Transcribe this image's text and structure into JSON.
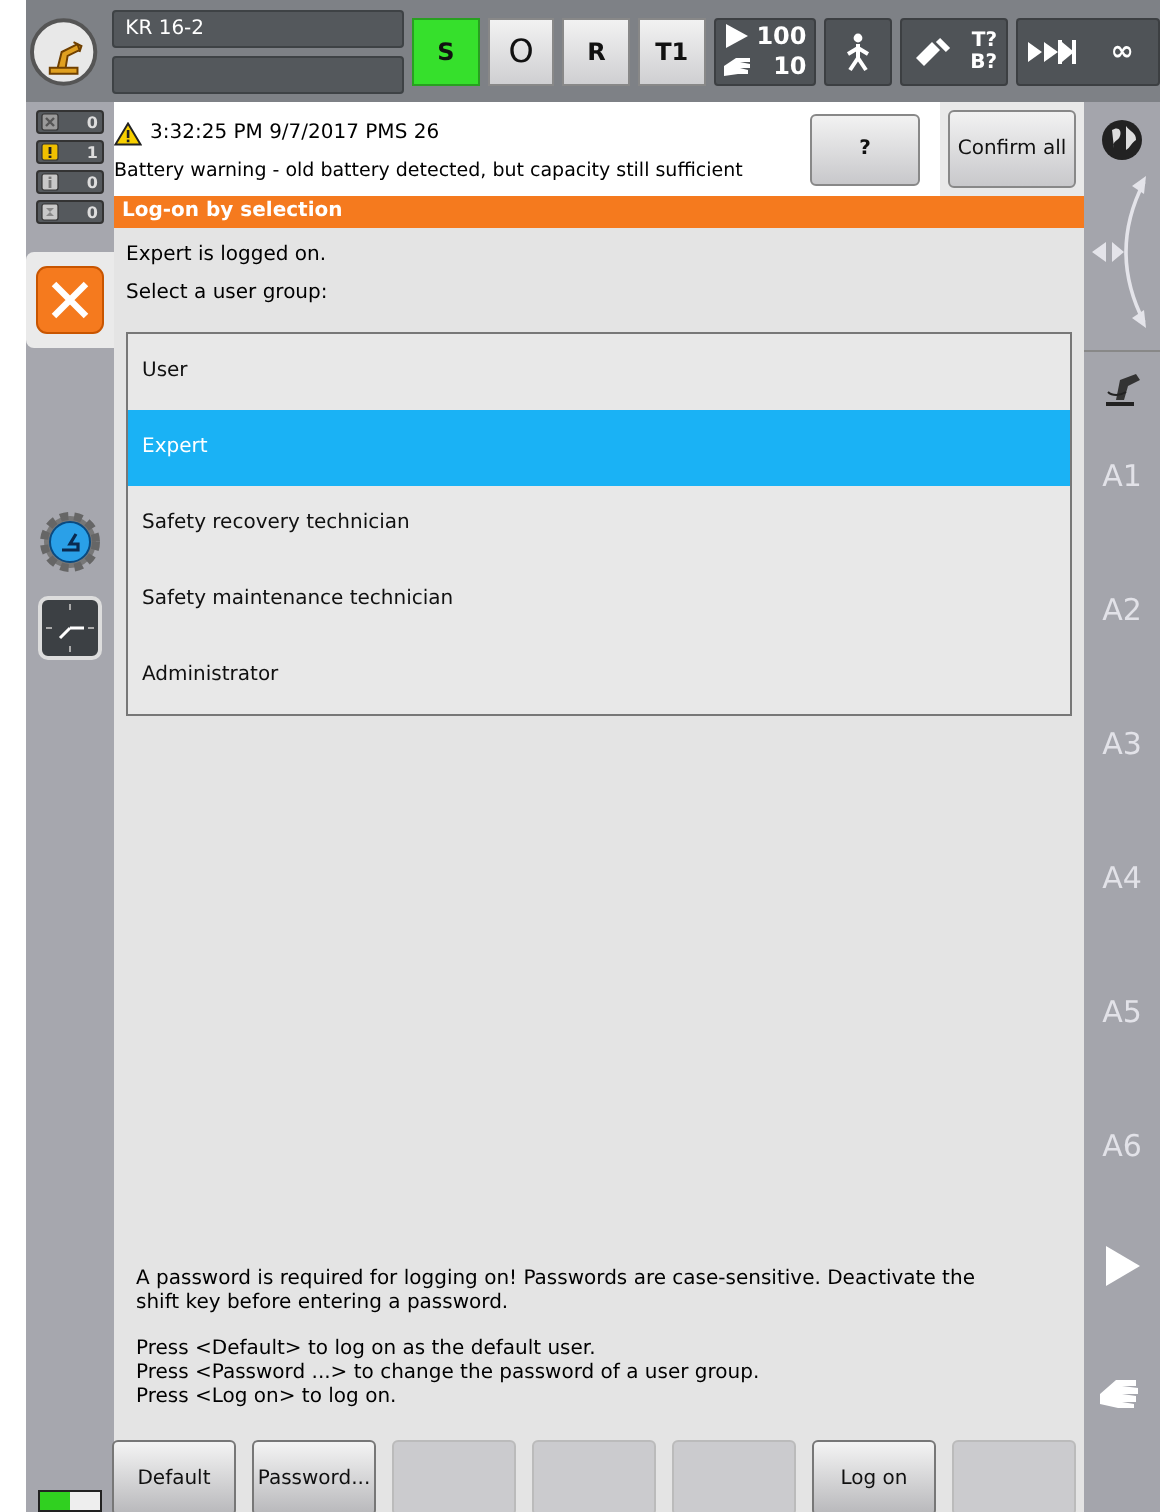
{
  "header": {
    "robot_name": "KR 16-2",
    "status_keys": [
      {
        "label": "S",
        "selected": true
      },
      {
        "label": "O",
        "kind": "circle",
        "selected": false
      },
      {
        "label": "R",
        "selected": false
      },
      {
        "label": "T1",
        "selected": false
      }
    ],
    "override": {
      "program": "100",
      "jog": "10"
    },
    "tool": {
      "tool": "T?",
      "base": "B?"
    },
    "increment": "∞"
  },
  "message_counters": [
    {
      "kind": "acknowledge",
      "count": "0"
    },
    {
      "kind": "warning",
      "count": "1"
    },
    {
      "kind": "info",
      "count": "0"
    },
    {
      "kind": "wait",
      "count": "0"
    }
  ],
  "message": {
    "kind": "warning",
    "header": "3:32:25 PM 9/7/2017 PMS 26",
    "text": "Battery warning - old battery detected, but capacity still sufficient",
    "help_label": "?",
    "confirm_label": "Confirm all"
  },
  "dialog": {
    "title": "Log-on by selection",
    "status": "Expert is logged on.",
    "prompt": "Select a user group:",
    "groups": [
      {
        "label": "User",
        "selected": false
      },
      {
        "label": "Expert",
        "selected": true
      },
      {
        "label": "Safety recovery technician",
        "selected": false
      },
      {
        "label": "Safety maintenance technician",
        "selected": false
      },
      {
        "label": "Administrator",
        "selected": false
      }
    ],
    "notes": [
      "A password is required for logging on! Passwords are case-sensitive. Deactivate the shift key before entering a password.",
      "Press <Default> to log on as the default user.\nPress <Password ...> to change the password of a user group.\nPress <Log on> to log on."
    ]
  },
  "softkeys": [
    {
      "label": "Default",
      "enabled": true
    },
    {
      "label": "Password...",
      "enabled": true
    },
    {
      "enabled": false
    },
    {
      "enabled": false
    },
    {
      "enabled": false
    },
    {
      "label": "Log on",
      "enabled": true
    },
    {
      "enabled": false
    }
  ],
  "axis_keys": [
    "A1",
    "A2",
    "A3",
    "A4",
    "A5",
    "A6"
  ],
  "battery": {
    "level": 0.5
  }
}
